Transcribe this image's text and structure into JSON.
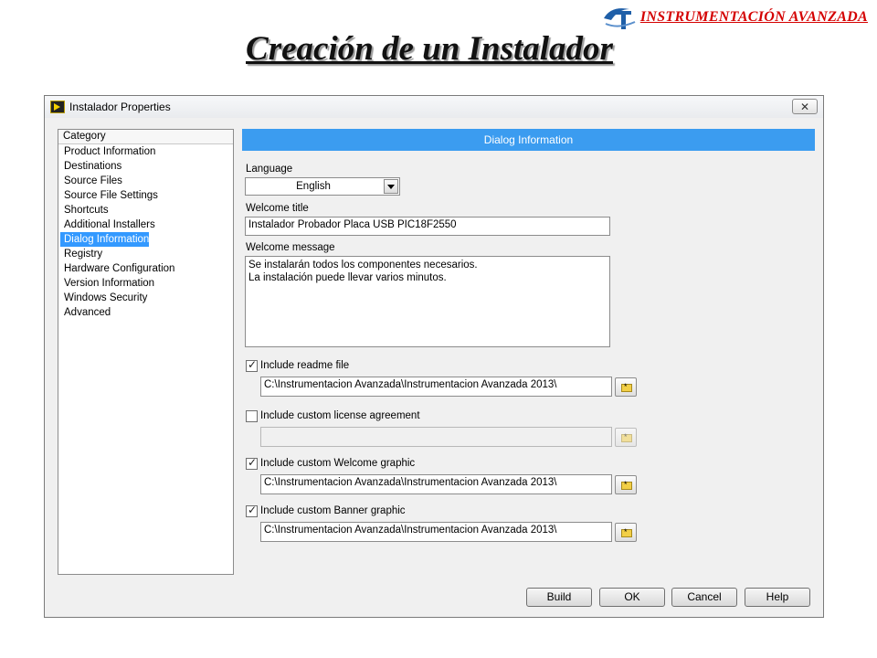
{
  "header": {
    "brand": "INSTRUMENTACIÓN AVANZADA",
    "title": "Creación de un Instalador"
  },
  "window": {
    "title": "Instalador Properties",
    "close_label": "✕"
  },
  "category": {
    "header": "Category",
    "items": [
      "Product Information",
      "Destinations",
      "Source Files",
      "Source File Settings",
      "Shortcuts",
      "Additional Installers",
      "Dialog Information",
      "Registry",
      "Hardware Configuration",
      "Version Information",
      "Windows Security",
      "Advanced"
    ],
    "selected": "Dialog Information"
  },
  "dialog": {
    "section_title": "Dialog Information",
    "language_label": "Language",
    "language_value": "English",
    "welcome_title_label": "Welcome title",
    "welcome_title_value": "Instalador Probador Placa USB PIC18F2550",
    "welcome_message_label": "Welcome message",
    "welcome_message_lines": [
      "Se instalarán todos los componentes necesarios.",
      "La instalación puede llevar varios minutos."
    ],
    "readme": {
      "label": "Include readme file",
      "checked": true,
      "path": "C:\\Instrumentacion Avanzada\\Instrumentacion Avanzada 2013\\"
    },
    "license": {
      "label": "Include custom license agreement",
      "checked": false,
      "path": ""
    },
    "welcome_graphic": {
      "label": "Include custom Welcome graphic",
      "checked": true,
      "path": "C:\\Instrumentacion Avanzada\\Instrumentacion Avanzada 2013\\"
    },
    "banner_graphic": {
      "label": "Include custom Banner graphic",
      "checked": true,
      "path": "C:\\Instrumentacion Avanzada\\Instrumentacion Avanzada 2013\\"
    }
  },
  "buttons": {
    "build": "Build",
    "ok": "OK",
    "cancel": "Cancel",
    "help": "Help"
  },
  "colors": {
    "accent": "#3b9cf0",
    "selection": "#3399ff",
    "brand": "#d40000"
  }
}
